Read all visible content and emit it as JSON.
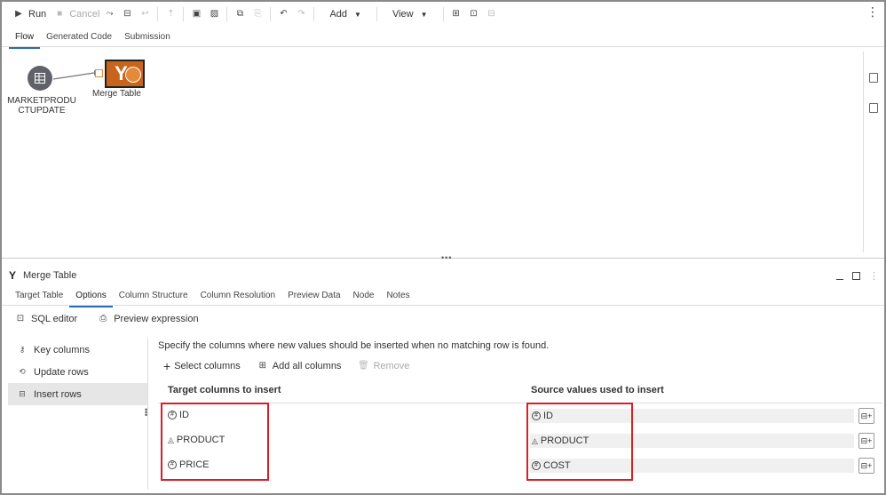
{
  "toolbar": {
    "run_label": "Run",
    "cancel_label": "Cancel",
    "add_label": "Add",
    "view_label": "View"
  },
  "top_tabs": [
    "Flow",
    "Generated Code",
    "Submission"
  ],
  "canvas": {
    "source_node_label": "MARKETPRODUCTUPDATE",
    "merge_node_label": "Merge Table"
  },
  "panel": {
    "title": "Merge Table",
    "tabs": [
      "Target Table",
      "Options",
      "Column Structure",
      "Column Resolution",
      "Preview Data",
      "Node",
      "Notes"
    ],
    "sql_editor_label": "SQL editor",
    "preview_expression_label": "Preview expression"
  },
  "left_nav": [
    "Key columns",
    "Update rows",
    "Insert rows"
  ],
  "insert": {
    "description": "Specify the columns where new values should be inserted when no matching row is found.",
    "select_columns_label": "Select columns",
    "add_all_columns_label": "Add all columns",
    "remove_label": "Remove",
    "target_header": "Target columns to insert",
    "source_header": "Source values used to insert",
    "target_rows": [
      {
        "name": "ID",
        "type": "numeric"
      },
      {
        "name": "PRODUCT",
        "type": "character"
      },
      {
        "name": "PRICE",
        "type": "numeric"
      }
    ],
    "source_rows": [
      {
        "name": "ID",
        "type": "numeric"
      },
      {
        "name": "PRODUCT",
        "type": "character"
      },
      {
        "name": "COST",
        "type": "numeric"
      }
    ]
  },
  "colors": {
    "merge_node": "#c8641b",
    "highlight": "#d81f26",
    "active_tab": "#2b6cb0"
  }
}
